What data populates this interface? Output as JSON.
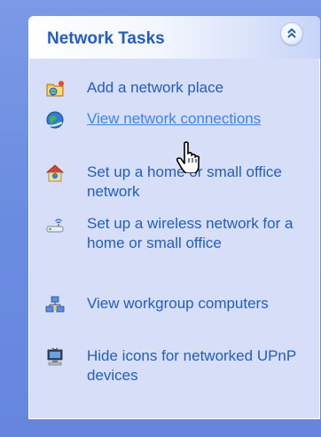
{
  "panel": {
    "title": "Network Tasks",
    "collapse_icon": "chevron-double-up-icon"
  },
  "tasks": [
    {
      "label": "Add a network place",
      "icon": "network-place-icon",
      "hovered": false
    },
    {
      "label": "View network connections",
      "icon": "network-connections-icon",
      "hovered": true
    },
    {
      "label": "Set up a home or small office network",
      "icon": "home-network-icon",
      "hovered": false
    },
    {
      "label": "Set up a wireless network for a home or small office",
      "icon": "wireless-network-icon",
      "hovered": false
    },
    {
      "label": "View workgroup computers",
      "icon": "workgroup-icon",
      "hovered": false
    },
    {
      "label": "Hide icons for networked UPnP devices",
      "icon": "upnp-device-icon",
      "hovered": false
    }
  ],
  "cursor": "hand-pointer-icon",
  "colors": {
    "title": "#215dc6",
    "link": "#215dc6",
    "link_hover": "#3d83f5",
    "body_bg": "#d6dff7",
    "backdrop": "#6f8fe3"
  }
}
